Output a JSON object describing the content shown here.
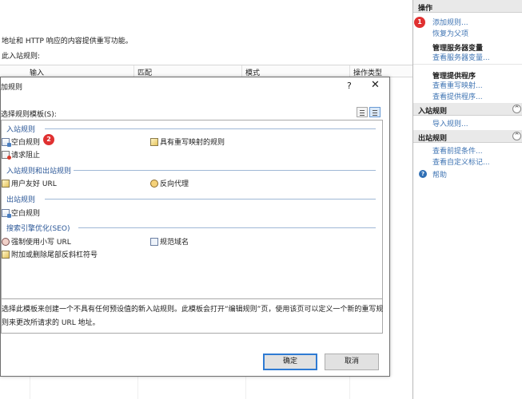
{
  "background": {
    "description": "地址和 HTTP 响应的内容提供重写功能。",
    "sub_label": "此入站规则:",
    "columns": [
      "输入",
      "匹配",
      "模式",
      "操作类型"
    ]
  },
  "actions_pane": {
    "header": "操作",
    "add_rule": "添加规则...",
    "revert_parent": "恢复为父项",
    "manage_server_vars": "管理服务器变量",
    "view_server_vars": "查看服务器变量...",
    "manage_providers": "管理提供程序",
    "view_rewrite_maps": "查看重写映射...",
    "view_providers": "查看提供程序...",
    "inbound_header": "入站规则",
    "import_rules": "导入规则...",
    "outbound_header": "出站规则",
    "view_preconditions": "查看前提条件...",
    "view_custom_tags": "查看自定义标记...",
    "help": "帮助",
    "collapse_glyph": "^"
  },
  "badges": {
    "badge1": "1",
    "badge2": "2"
  },
  "dialog": {
    "title": "加规则",
    "help_glyph": "?",
    "close_glyph": "✕",
    "template_label": "选择规则模板(S):",
    "groups": {
      "inbound": "入站规则",
      "inbound_outbound": "入站规则和出站规则",
      "outbound": "出站规则",
      "seo": "搜索引擎优化(SEO)"
    },
    "items": {
      "blank_inbound": "空白规则",
      "rewrite_map_rule": "具有重写映射的规则",
      "request_block": "请求阻止",
      "user_friendly_url": "用户友好 URL",
      "reverse_proxy": "反向代理",
      "blank_outbound": "空白规则",
      "enforce_lowercase": "强制使用小写 URL",
      "canonical_domain": "规范域名",
      "trailing_slash": "附加或删除尾部反斜杠符号"
    },
    "description_line1": "选择此模板来创建一个不具有任何预设值的新入站规则。此模板会打开“编辑规则”页，使用该页可以定义一个新的重写规",
    "description_line2": "则来更改所请求的 URL 地址。",
    "ok_label": "确定",
    "cancel_label": "取消"
  },
  "colors": {
    "link": "#3f74b3",
    "badge": "#e03131",
    "group_text": "#2b5797",
    "primary_border": "#2f7bd3"
  }
}
